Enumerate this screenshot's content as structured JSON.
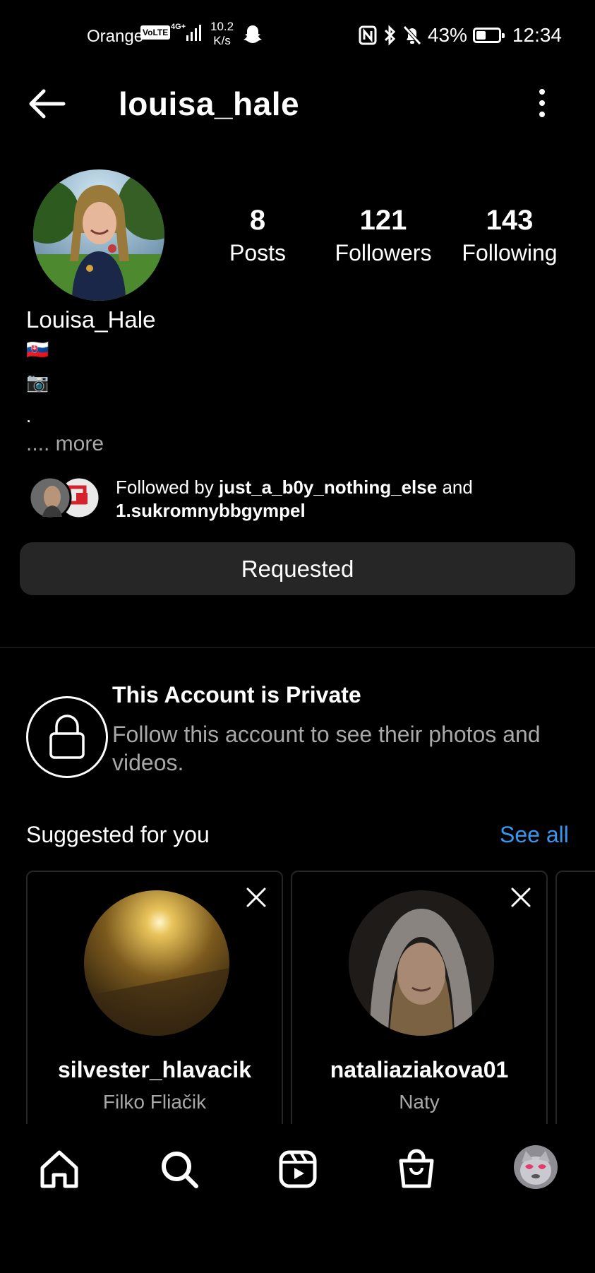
{
  "status_bar": {
    "carrier": "Orange",
    "volte": "VoLTE",
    "network": "4G+",
    "speed_value": "10.2",
    "speed_unit": "K/s",
    "battery_pct": "43%",
    "battery_level": 0.43,
    "time": "12:34"
  },
  "header": {
    "username": "louisa_hale"
  },
  "profile": {
    "stats": [
      {
        "value": "8",
        "label": "Posts"
      },
      {
        "value": "121",
        "label": "Followers"
      },
      {
        "value": "143",
        "label": "Following"
      }
    ],
    "full_name": "Louisa_Hale",
    "bio_lines": [
      "🇸🇰",
      "📷",
      "."
    ],
    "more": ".... more",
    "followed_by_prefix": "Followed by",
    "followed_by_user1": "just_a_b0y_nothing_else",
    "followed_by_and": "and",
    "followed_by_user2": "1.sukromnybbgympel",
    "requested_label": "Requested"
  },
  "private_notice": {
    "title": "This Account is Private",
    "subtitle": "Follow this account to see their photos and videos."
  },
  "suggestions": {
    "title": "Suggested for you",
    "see_all": "See all",
    "cards": [
      {
        "username": "silvester_hlavacik",
        "name": "Filko Fliačik"
      },
      {
        "username": "nataliaziakova01",
        "name": "Naty"
      }
    ]
  },
  "bottom_nav": {
    "items": [
      "home-icon",
      "search-icon",
      "reels-icon",
      "shop-icon",
      "profile-avatar"
    ]
  },
  "colors": {
    "background": "#000000",
    "button_bg": "#262626",
    "secondary_text": "#a8a8a8",
    "link": "#3797f0"
  }
}
